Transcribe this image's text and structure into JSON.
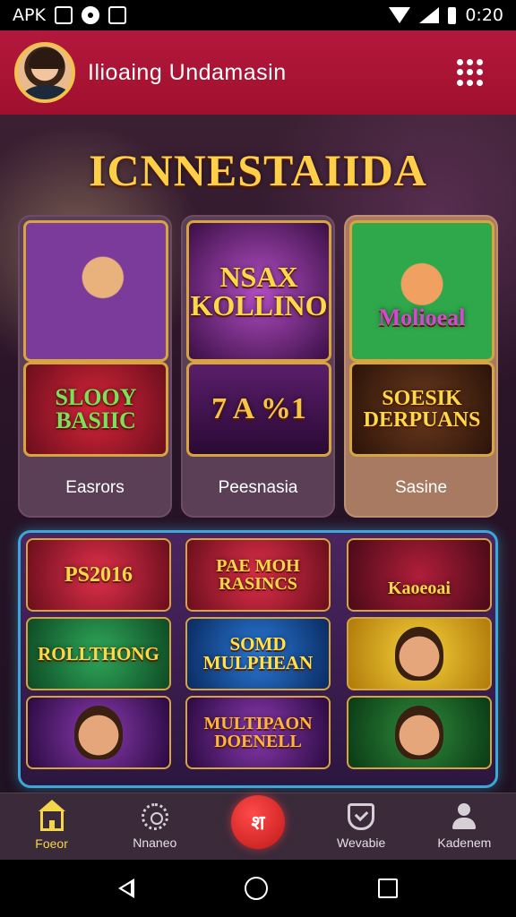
{
  "status_bar": {
    "carrier": "APK",
    "time": "0:20"
  },
  "header": {
    "title": "Ilioaing Undamasin"
  },
  "banner": {
    "title": "ICNNESTAIIDA"
  },
  "top_cards": [
    {
      "label": "Easrors",
      "image_top_text": "",
      "image_bottom_text": "SLOOY BASIIC"
    },
    {
      "label": "Peesnasia",
      "image_top_text": "NSAX KOLLINO",
      "image_bottom_text": "7 A %1"
    },
    {
      "label": "Sasine",
      "image_top_text": "Molioeal",
      "image_bottom_text": "SOESIK DERPUANS"
    }
  ],
  "grid_tiles": [
    {
      "text": "PS2016"
    },
    {
      "text": "PAE MOH RASINCS"
    },
    {
      "text": "Kaoeoai"
    },
    {
      "text": "ROLLTHONG"
    },
    {
      "text": "SOMD MULPHEAN"
    },
    {
      "text": ""
    },
    {
      "text": ""
    },
    {
      "text": "MULTIPAON DOENELL"
    },
    {
      "text": ""
    }
  ],
  "bottom_nav": [
    {
      "label": "Foeor",
      "icon": "home-icon"
    },
    {
      "label": "Nnaneo",
      "icon": "gear-icon"
    },
    {
      "label": "",
      "icon": "center-logo",
      "glyph": "श"
    },
    {
      "label": "Wevabie",
      "icon": "shield-icon"
    },
    {
      "label": "Kadenem",
      "icon": "user-icon"
    }
  ],
  "colors": {
    "header": "#b3183c",
    "accent_gold": "#ffcf4a",
    "panel_border": "#3aa8d8",
    "nav_active": "#f5d64a"
  }
}
